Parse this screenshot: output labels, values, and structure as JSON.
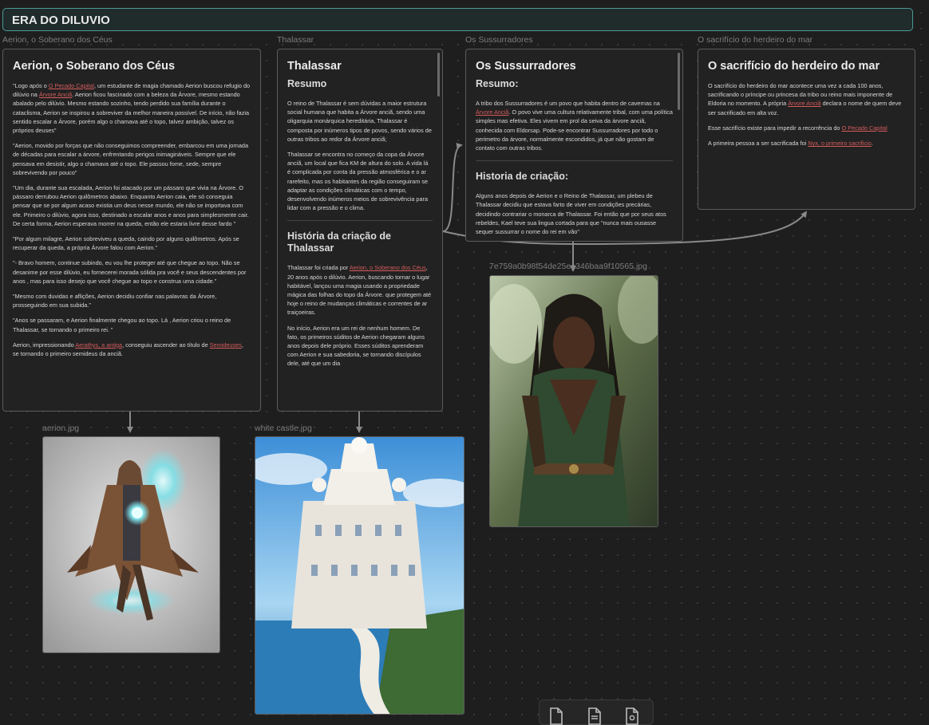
{
  "group": {
    "title": "ERA DO DILUVIO"
  },
  "cards": {
    "aerion": {
      "label": "Aerion, o Soberano dos Céus",
      "title": "Aerion, o Soberano dos Céus",
      "p1_a": "\"Logo após o ",
      "p1_link1": "O Pecado Capital",
      "p1_b": ", um estudante de magia chamado Aerion buscou refugio do dilúvio na ",
      "p1_link2": "Árvore Anciã",
      "p1_c": ". Aerion ficou fascinado com a beleza da Árvore, mesmo estando abalado pelo dilúvio. Mesmo estando sozinho, tendo perdido sua família durante o cataclisma, Aerion se inspirou a sobreviver da melhor maneira possível. De início, não fazia sentido escalar a Árvore, porém algo o chamava até o topo, talvez ambição, talvez os próprios deuses\"",
      "p2": "\"Aerion, movido por forças que não conseguimos compreender, embarcou em uma jornada de décadas para escalar a árvore, enfrentando perigos inimagináveis. Sempre que ele pensava em desistir, algo o chamava até o topo. Ele passou fome, sede, sempre sobrevivendo por pouco\"",
      "p3": "\"Um dia, durante sua escalada, Aerion foi atacado por um pássaro que vivia na Árvore. O pássaro derrubou Aerion quilômetros abaixo. Enquanto Aerion caia, ele só conseguia pensar que se por algum acaso existia um deus nesse mundo, ele não se importava com ele. Primeiro o dilúvio, agora isso, destinado a escalar anos e anos para simplesmente cair. De certa forma, Aerion esperava morrer na queda, então ele estaria livre desse fardo \"",
      "p4": "\"Por algum milagre, Aerion sobreviveu a queda, caindo por alguns quilômetros. Após se recuperar da queda, a própria Árvore falou com Aerion.\"",
      "p5": "\"- Bravo homem, continue subindo, eu vou lhe proteger até que chegue ao topo. Não se desanime por esse dilúvio, eu fornecerei morada sólida pra você e seus descendentes por anos , mas para isso desejo que você chegue ao topo e construa uma cidade.\"",
      "p6": "\"Mesmo com duvidas e aflições, Aerion decidiu confiar nas palavras da Árvore, prosseguindo em sua subida.\"",
      "p7": "\"Anos se passaram, e Aerion finalmente chegou ao topo. Lá , Aerion criou o reino de Thalassar, se tornando o primeiro rei. \"",
      "p8_a": "Aerion, impressionando ",
      "p8_link1": "Aerathys, a antiga",
      "p8_b": ", conseguiu ascender ao título de ",
      "p8_link2": "Semideuses",
      "p8_c": ", se tornando o primeiro semideus da anciã."
    },
    "thalassar": {
      "label": "Thalassar",
      "title": "Thalassar",
      "h_resumo": "Resumo",
      "p1": "O reino de Thalassar é sem dúvidas a maior estrutura social humana que habita a Árvore anciã, sendo uma oligarquia monárquica hereditária, Thalassar é composta por inúmeros tipos de povos, sendo vários de outras tribos ao redor da Árvore anciã;",
      "p2": "Thalassar se encontra no começo da copa da Árvore anciã, um local que fica KM de altura do solo. A vida lá é complicada por conta da pressão atmosférica e o ar rarefeito, mas os habitantes da região conseguiram se adaptar as condições climáticas com o tempo, desenvolvendo inúmeros meios de sobrevivência para lidar com a pressão e o clima.",
      "h_historia": "História da criação de Thalassar",
      "p3_a": "Thalassar foi criada por ",
      "p3_link": "Aerion, o Soberano dos Céus",
      "p3_b": ", 20 anos após o dilúvio. Aerion, buscando tornar o lugar habitável, lançou uma magia usando a propriedade mágica das folhas do topo da Árvore. que protegem até hoje o reino de mudanças climáticas e correntes de ar traiçoeiras.",
      "p4": "No início, Aerion era um rei de nenhum homem. De fato, os primeiros súditos de Aerion chegaram alguns anos depois dele próprio. Esses súditos aprenderam com Aerion e sua sabedoria, se tornando discípulos dele, até que um dia"
    },
    "sussurradores": {
      "label": "Os Sussurradores",
      "title": "Os Sussurradores",
      "h_resumo": "Resumo:",
      "p1_a": "A tribo dos Sussurradores é um povo que habita dentro de cavernas na ",
      "p1_link": "Árvore Anciã",
      "p1_b": ". O povo vive uma cultura relativamente tribal, com uma política simples mas efetiva. Eles vivem em prol da seiva da árvore anciã, conhecida com Eldorsap. Pode-se encontrar Sussurradores por todo o perimetro da árvore, normalmente escondidos, já que não gostam de contato com outras tribos.",
      "h_historia": "Historia de criação:",
      "p2": "Alguns anos depois de Aerion e o Reino de Thalassar, um plebeu de Thalassar decidiu que estava farto de viver em condições precárias, decidindo contrariar o monarca de Thalassar. Foi então que por seus atos rebeldes, Kael teve sua lingua cortada para que \"nunca mais ousasse sequer sussurrar o nome do rei em vão\""
    },
    "sacrificio": {
      "label": "O sacrifício do herdeiro do mar",
      "title": "O sacrifício do herdeiro do mar",
      "p1_a": "O sacrifício do herdeiro do mar acontece uma vez a cada 100 anos, sacrificando o príncipe ou princesa da tribo ou reino mais imponente de Eldoria no momento. A própria ",
      "p1_link": "Árvore Anciã",
      "p1_b": " declara o nome de quem deve ser sacrificado em alta voz.",
      "p2_a": "Esse sacrifício existe para impedir a recorrência do ",
      "p2_link": "O Pecado Capital",
      "p3_a": "A primeira pessoa a ser sacrificada foi ",
      "p3_link": "Nyx, o primeiro sacrificio",
      "p3_b": "."
    }
  },
  "images": {
    "aerion": {
      "label": "aerion.jpg"
    },
    "castle": {
      "label": "white castle.jpg"
    },
    "woman": {
      "label": "7e759a0b98f54de25ea346baa9f10565.jpg"
    }
  },
  "toolbar": {
    "icons": [
      "file-icon",
      "note-icon",
      "media-icon"
    ]
  },
  "colors": {
    "group_border": "#4a9a94",
    "link": "#d55b5b",
    "edge": "#8a8a8a"
  }
}
